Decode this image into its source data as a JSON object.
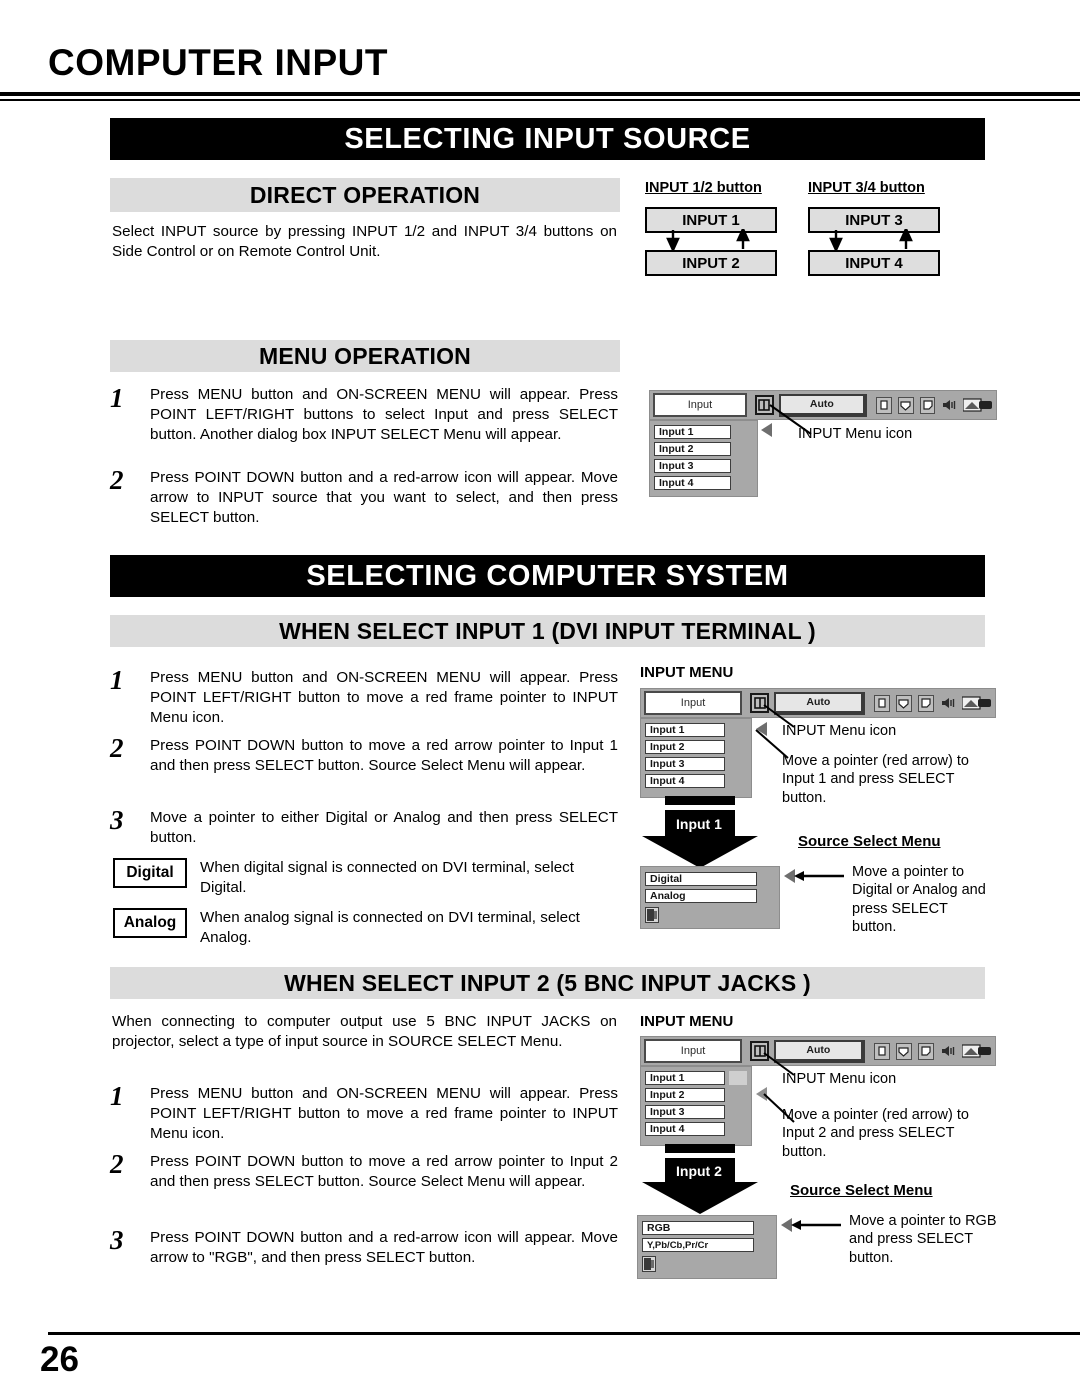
{
  "page": {
    "title": "COMPUTER INPUT",
    "number": "26"
  },
  "section1": {
    "banner": "SELECTING INPUT SOURCE",
    "direct": {
      "heading": "DIRECT OPERATION",
      "body": "Select INPUT source by pressing INPUT 1/2 and INPUT 3/4 buttons on Side Control or on Remote Control Unit."
    },
    "button_diagram": {
      "group1_caption": "INPUT 1/2 button",
      "group1_top": "INPUT 1",
      "group1_bottom": "INPUT 2",
      "group2_caption": "INPUT 3/4 button",
      "group2_top": "INPUT 3",
      "group2_bottom": "INPUT 4"
    },
    "menu": {
      "heading": "MENU OPERATION",
      "steps": [
        {
          "num": "1",
          "text": "Press MENU button and ON-SCREEN MENU will appear.  Press POINT LEFT/RIGHT buttons to select Input and press  SELECT button.  Another dialog box INPUT SELECT Menu will appear."
        },
        {
          "num": "2",
          "text": "Press POINT DOWN button and a red-arrow icon will appear. Move arrow to INPUT source that you want to select, and then press SELECT button."
        }
      ],
      "osd": {
        "tab_label": "Input",
        "auto_label": "Auto",
        "items": [
          "Input 1",
          "Input 2",
          "Input 3",
          "Input 4"
        ],
        "callout": "INPUT Menu icon"
      }
    }
  },
  "section2": {
    "banner": "SELECTING COMPUTER SYSTEM",
    "input1": {
      "heading": "WHEN SELECT  INPUT 1 (DVI INPUT TERMINAL )",
      "steps": [
        {
          "num": "1",
          "text": "Press MENU button and ON-SCREEN MENU will appear.  Press POINT LEFT/RIGHT button to move a red frame pointer to INPUT Menu icon."
        },
        {
          "num": "2",
          "text": "Press POINT DOWN button to move a red arrow pointer to Input 1 and then press SELECT button.  Source Select Menu will appear."
        },
        {
          "num": "3",
          "text": "Move a pointer to either Digital or Analog and then press SELECT button."
        }
      ],
      "keys": [
        {
          "label": "Digital",
          "text": "When digital signal is connected on DVI terminal, select Digital."
        },
        {
          "label": "Analog",
          "text": "When analog signal is connected on DVI terminal, select Analog."
        }
      ],
      "osd": {
        "title": "INPUT MENU",
        "tab_label": "Input",
        "auto_label": "Auto",
        "items": [
          "Input 1",
          "Input 2",
          "Input 3",
          "Input 4"
        ],
        "icon_callout": "INPUT Menu icon",
        "pointer_callout": "Move a pointer (red arrow) to Input 1 and press SELECT button.",
        "banner_label": "Input 1",
        "source_menu_title": "Source Select Menu",
        "source_items": [
          "Digital",
          "Analog"
        ],
        "source_callout": "Move a pointer to Digital or Analog and press SELECT button."
      }
    },
    "input2": {
      "heading": "WHEN SELECT INPUT 2 (5 BNC INPUT JACKS )",
      "intro": "When connecting to computer output use 5 BNC INPUT JACKS on projector, select a type of input source in SOURCE SELECT Menu.",
      "steps": [
        {
          "num": "1",
          "text": "Press MENU button and ON-SCREEN MENU will appear.  Press POINT LEFT/RIGHT button to move a red frame pointer to INPUT Menu icon."
        },
        {
          "num": "2",
          "text": "Press POINT DOWN button to move a red arrow pointer to Input 2 and then press SELECT button.  Source Select Menu will appear."
        },
        {
          "num": "3",
          "text": "Press POINT DOWN button and a red-arrow icon will appear. Move arrow to \"RGB\", and then press SELECT button."
        }
      ],
      "osd": {
        "title": "INPUT MENU",
        "tab_label": "Input",
        "auto_label": "Auto",
        "items": [
          "Input 1",
          "Input 2",
          "Input 3",
          "Input 4"
        ],
        "icon_callout": "INPUT Menu icon",
        "pointer_callout": "Move a pointer (red arrow) to Input 2 and press SELECT button.",
        "banner_label": "Input 2",
        "source_menu_title": "Source Select Menu",
        "source_items": [
          "RGB",
          "Y,Pb/Cb,Pr/Cr"
        ],
        "source_callout": "Move a pointer to RGB and press SELECT button."
      }
    }
  },
  "colors": {
    "banner_bg": "#000000",
    "subhead_bg": "#dcdcdc",
    "osd_gray": "#a8a8a8",
    "button_gray": "#dedede"
  }
}
